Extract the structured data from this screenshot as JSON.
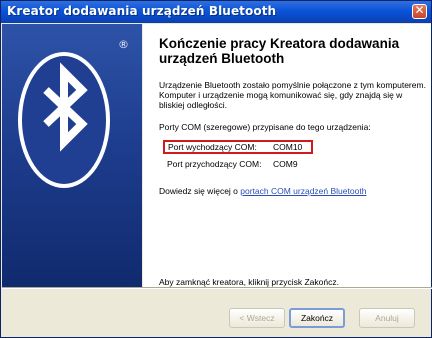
{
  "window": {
    "title": "Kreator dodawania urządzeń Bluetooth",
    "close_glyph": "✕"
  },
  "banner": {
    "logo": "bluetooth-logo",
    "registered_mark": "®"
  },
  "content": {
    "heading": "Kończenie pracy Kreatora dodawania urządzeń Bluetooth",
    "description": "Urządzenie Bluetooth zostało pomyślnie połączone z tym komputerem. Komputer i urządzenie mogą komunikować się, gdy znajdą się w bliskiej odległości.",
    "ports_header": "Porty COM (szeregowe) przypisane do tego urządzenia:",
    "outgoing_port": {
      "label": "Port wychodzący COM:",
      "value": "COM10"
    },
    "incoming_port": {
      "label": "Port przychodzący COM:",
      "value": "COM9"
    },
    "learn_more_prefix": "Dowiedz się więcej o ",
    "learn_more_link": "portach COM urządzeń Bluetooth",
    "finish_hint": "Aby zamknąć kreatora, kliknij przycisk Zakończ."
  },
  "buttons": {
    "back": "< Wstecz",
    "finish": "Zakończ",
    "cancel": "Anuluj"
  },
  "colors": {
    "highlight_box": "#d11b1b",
    "banner_blue": "#1e3d8e",
    "title_blue": "#0a53d9"
  }
}
